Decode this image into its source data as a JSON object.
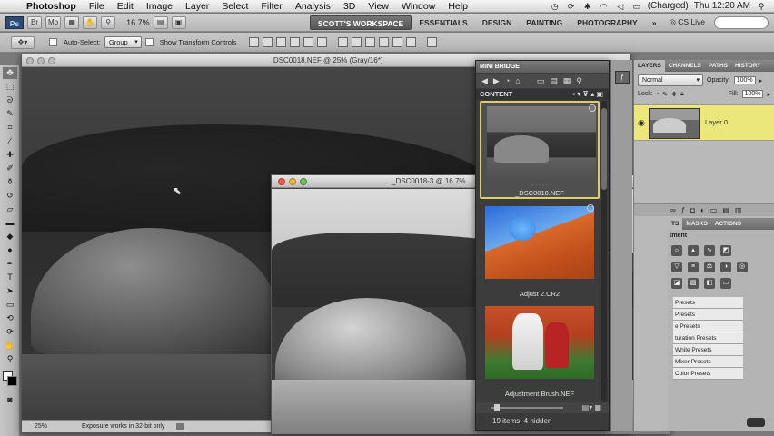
{
  "menubar": {
    "apple": "",
    "app_name": "Photoshop",
    "items": [
      "File",
      "Edit",
      "Image",
      "Layer",
      "Select",
      "Filter",
      "Analysis",
      "3D",
      "View",
      "Window",
      "Help"
    ],
    "battery": "(Charged)",
    "clock": "Thu 12:20 AM"
  },
  "appbar": {
    "ps_logo": "Ps",
    "zoom": "16.7%",
    "workspaces": [
      "SCOTT'S WORKSPACE",
      "ESSENTIALS",
      "DESIGN",
      "PAINTING",
      "PHOTOGRAPHY"
    ],
    "more": "»",
    "cslive": "CS Live"
  },
  "options": {
    "auto_select_label": "Auto-Select:",
    "auto_select_value": "Group",
    "transform_label": "Show Transform Controls"
  },
  "doc_main": {
    "title": "_DSC0018.NEF @ 25% (Gray/16*)",
    "zoom": "25%",
    "status": "Exposure works in 32-bit only"
  },
  "doc_second": {
    "title": "_DSC0018-3 @ 16.7%"
  },
  "minibridge": {
    "tab": "MINI BRIDGE",
    "content_label": "CONTENT",
    "items": [
      {
        "caption": "_DSC0018.NEF"
      },
      {
        "caption": "Adjust 2.CR2"
      },
      {
        "caption": "Adjustment Brush.NEF"
      }
    ],
    "status": "19 items, 4 hidden"
  },
  "layers": {
    "tabs": [
      "LAYERS",
      "CHANNELS",
      "PATHS",
      "HISTORY"
    ],
    "blend_mode": "Normal",
    "opacity_label": "Opacity:",
    "opacity_value": "100%",
    "lock_label": "Lock:",
    "fill_label": "Fill:",
    "fill_value": "100%",
    "layer_name": "Layer 0"
  },
  "adjustments": {
    "tabs": [
      "TS",
      "MASKS",
      "ACTIONS"
    ],
    "heading": "tment",
    "presets": [
      "Presets",
      "Presets",
      "e Presets",
      "turation Presets",
      "White Presets",
      "Mixer Presets",
      "Color Presets"
    ]
  },
  "colors": {
    "layer_selected": "#ece77b",
    "thumb_selected": "#d8cf6a",
    "workspace_active": "#5a5a5a"
  }
}
